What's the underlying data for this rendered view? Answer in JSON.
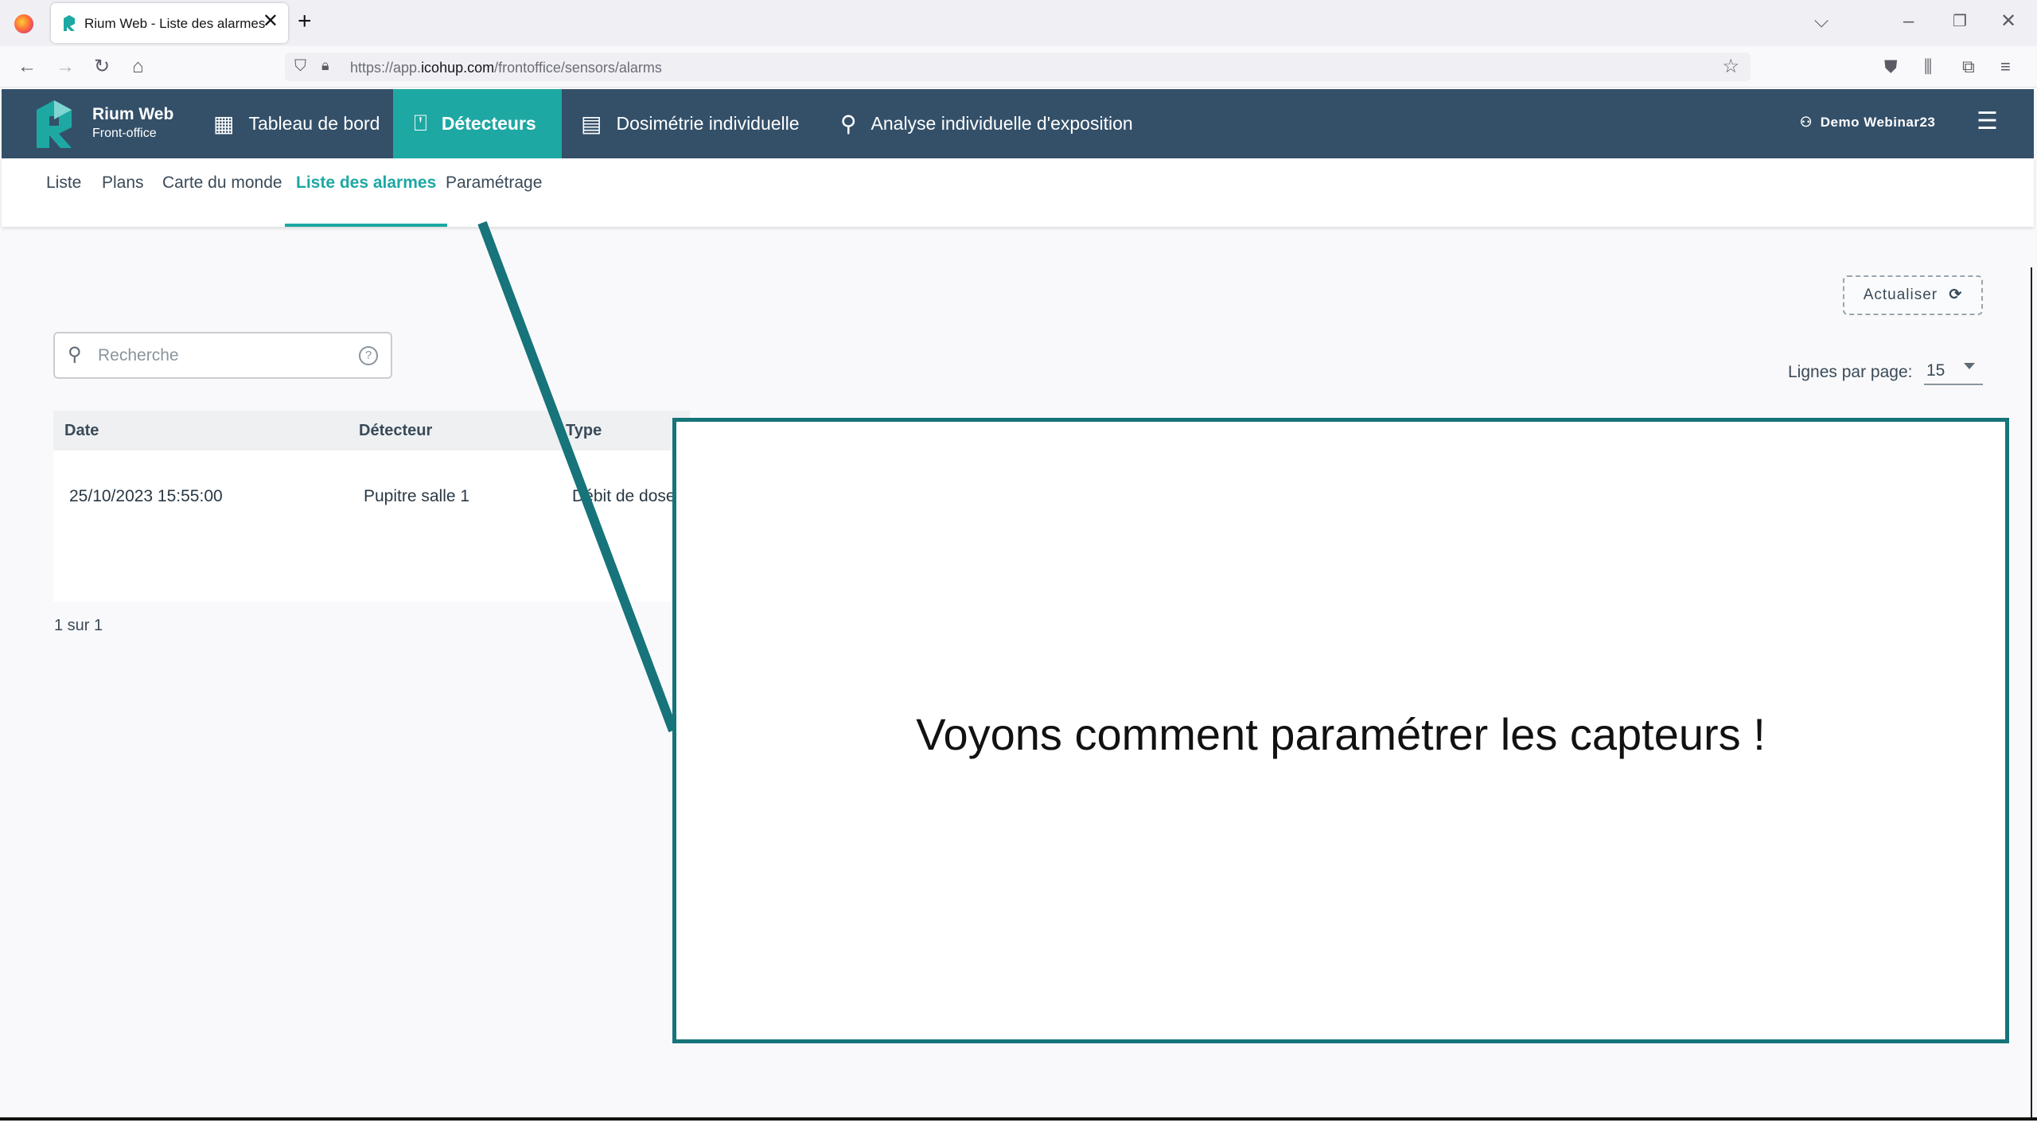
{
  "browser": {
    "tab_title": "Rium Web - Liste des alarmes",
    "new_tab": "+",
    "tab_close": "✕",
    "url_prefix": "https://app.",
    "url_domain": "icohup.com",
    "url_path": "/frontoffice/sensors/alarms"
  },
  "app": {
    "brand_name": "Rium Web",
    "brand_sub": "Front-office",
    "nav": [
      {
        "label": "Tableau de bord",
        "icon": "dashboard-icon"
      },
      {
        "label": "Détecteurs",
        "icon": "detector-icon",
        "active": true
      },
      {
        "label": "Dosimétrie individuelle",
        "icon": "id-card-icon"
      },
      {
        "label": "Analyse individuelle d'exposition",
        "icon": "person-search-icon"
      }
    ],
    "user": "Demo Webinar23",
    "accent_color": "#1ea8a3",
    "header_color": "#345069"
  },
  "subnav": [
    {
      "label": "Liste"
    },
    {
      "label": "Plans"
    },
    {
      "label": "Carte du monde"
    },
    {
      "label": "Liste des alarmes",
      "active": true
    },
    {
      "label": "Paramétrage"
    }
  ],
  "toolbar": {
    "refresh_label": "Actualiser",
    "search_placeholder": "Recherche",
    "rows_per_page_label": "Lignes par page:",
    "rows_per_page_value": "15"
  },
  "table": {
    "columns": [
      "Date",
      "Détecteur",
      "Type"
    ],
    "rows": [
      {
        "date": "25/10/2023 15:55:00",
        "detector": "Pupitre salle 1",
        "type": "Débit de dose"
      }
    ]
  },
  "pagination": "1 sur 1",
  "overlay": {
    "text": "Voyons comment paramétrer les capteurs !",
    "border_color": "#16747a"
  }
}
